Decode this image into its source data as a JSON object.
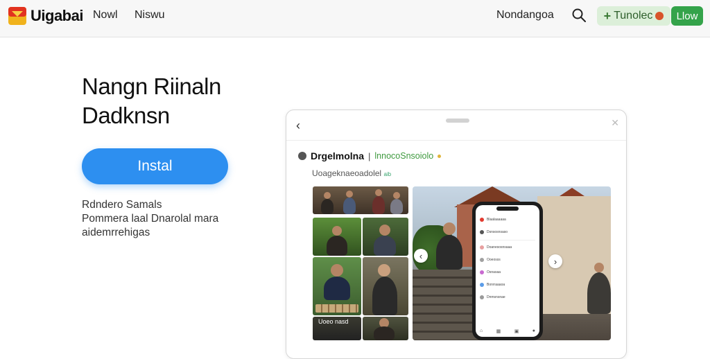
{
  "header": {
    "brand": "Uigabai",
    "nav": [
      "Nowl",
      "Niswu"
    ],
    "language": "Nondangoa",
    "cta_label": "Tunolec",
    "login_label": "Llow",
    "accent": "#34a34a",
    "cta_bg": "#dcefd9"
  },
  "hero": {
    "title_line1": "Nangn Riinaln",
    "title_line2": "Dadknsn",
    "install_label": "Instal",
    "install_color": "#2d8ff0",
    "desc_lines": [
      "Rdndero Samals",
      "Pommera laal Dnarolal mara",
      "aidemrrehigas"
    ]
  },
  "preview": {
    "app_name": "Drgelmolna",
    "separator": "|",
    "app_tag": "lnnocoSnsoiolo",
    "subtitle": "Uoageknaeoadolel",
    "subtitle_note": "aib",
    "photo_caption": "Uoeo nasd",
    "phone_rows": [
      "Blaalaaaaaa",
      "Dsnsosnsaso",
      "Doanesosnsaaa",
      "Ooeosss",
      "Osnasaa",
      "Bonrraaaoa",
      "Dnmsnsnae"
    ]
  },
  "icons": {
    "logo": "app-logo-icon",
    "search": "search-icon",
    "back": "back-arrow-icon",
    "close": "close-icon",
    "prev": "chevron-left-icon",
    "next": "chevron-right-icon"
  }
}
